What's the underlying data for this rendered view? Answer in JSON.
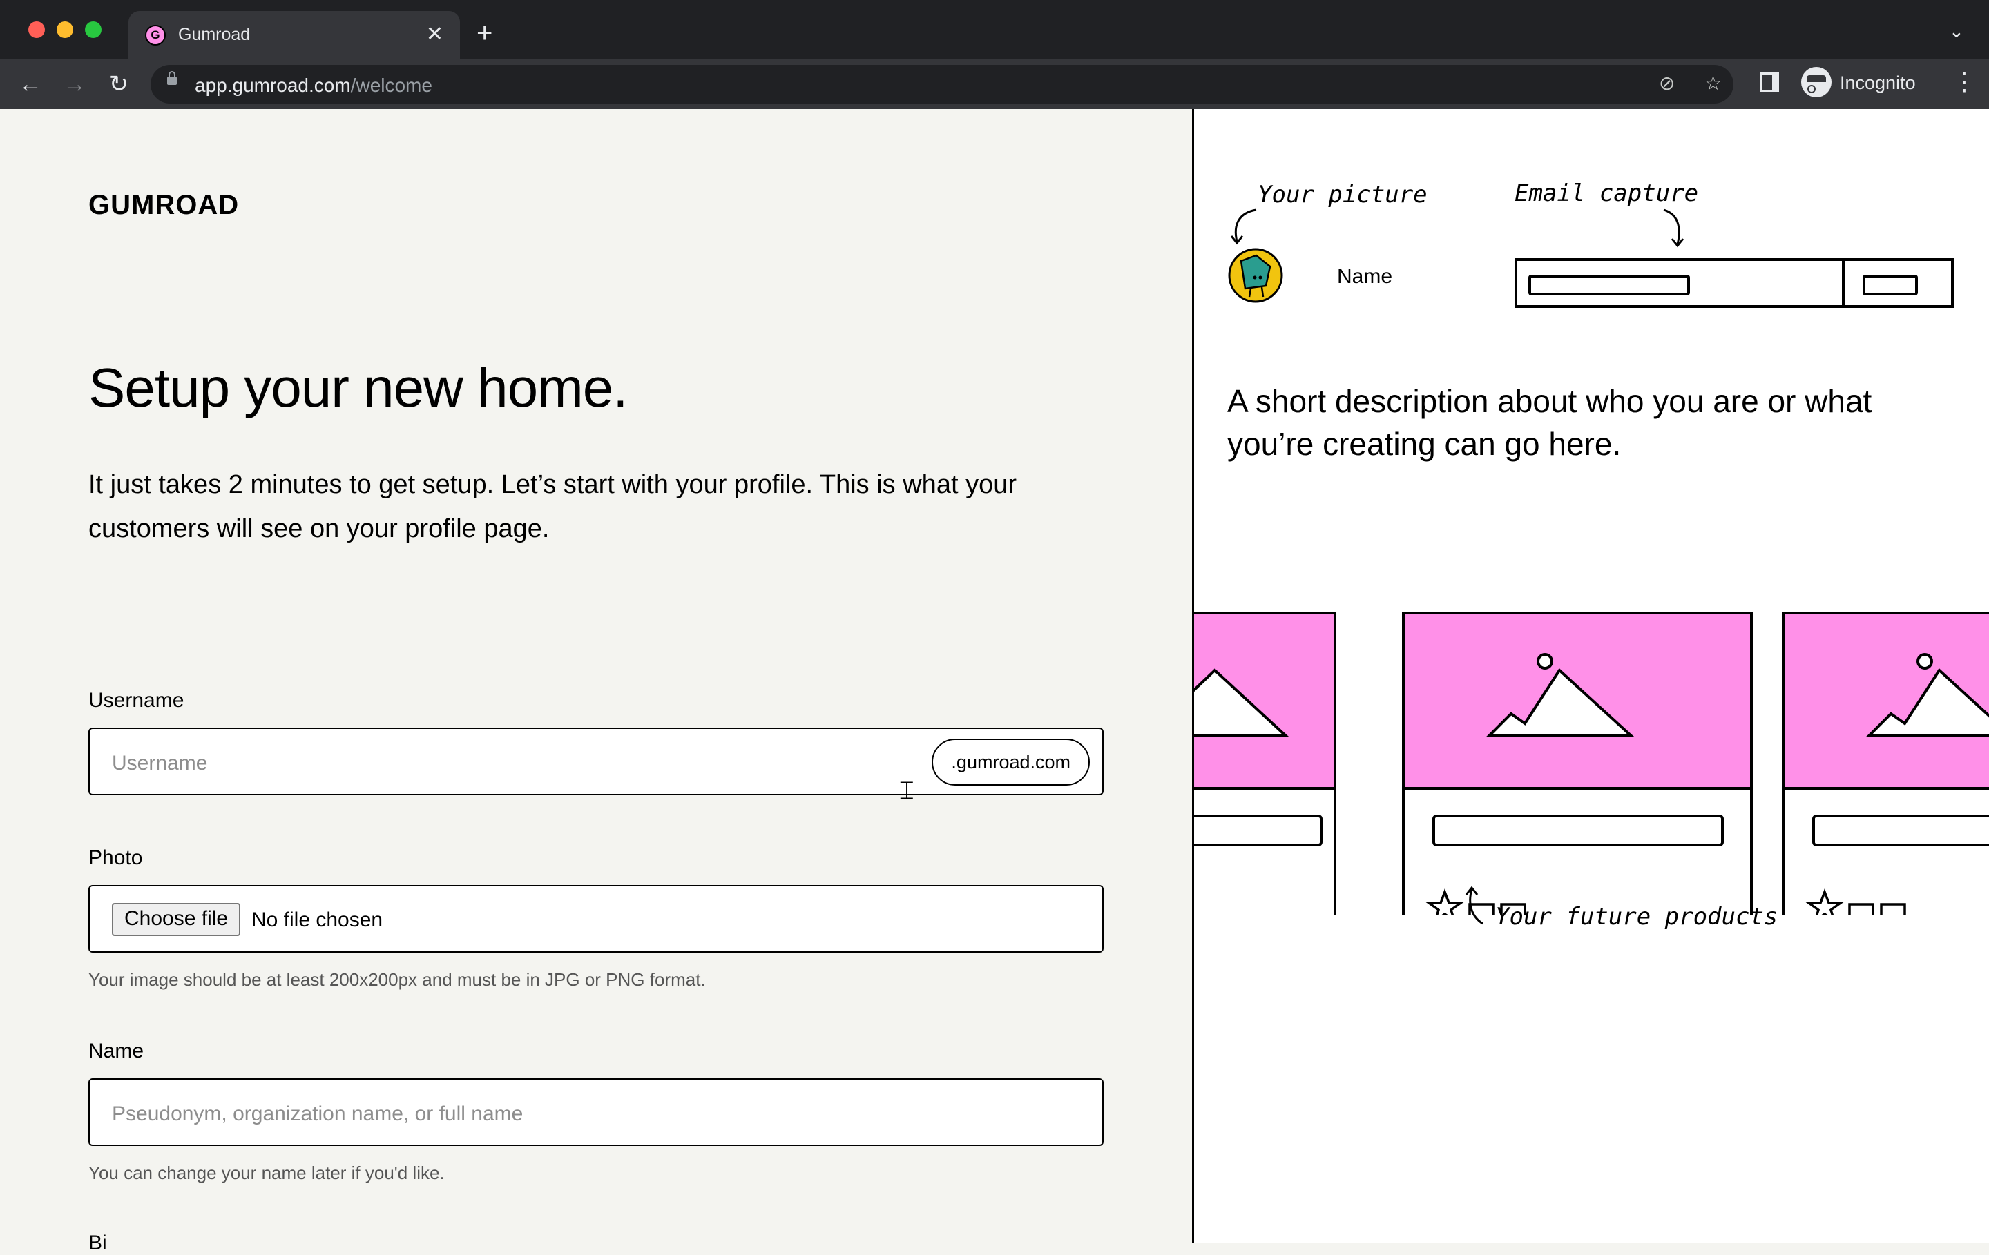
{
  "browser": {
    "tab_title": "Gumroad",
    "favicon_letter": "G",
    "url_host": "app.gumroad.com",
    "url_path": "/welcome",
    "profile_label": "Incognito"
  },
  "page": {
    "logo_text": "GUMROAD",
    "title": "Setup your new home.",
    "intro": "It just takes 2 minutes to get setup. Let’s start with your profile. This is what your customers will see on your profile page.",
    "username": {
      "label": "Username",
      "placeholder": "Username",
      "suffix": ".gumroad.com"
    },
    "photo": {
      "label": "Photo",
      "button": "Choose file",
      "status": "No file chosen",
      "hint": "Your image should be at least 200x200px and must be in JPG or PNG format."
    },
    "name": {
      "label": "Name",
      "placeholder": "Pseudonym, organization name, or full name",
      "hint": "You can change your name later if you'd like."
    },
    "next_label_partial": "Bi"
  },
  "preview": {
    "picture_annotation": "Your picture",
    "email_annotation": "Email capture",
    "name": "Name",
    "description": "A short description about who you are or what you’re creating can go here.",
    "products_annotation": "Your future products",
    "accent_color": "#ff90e8"
  }
}
